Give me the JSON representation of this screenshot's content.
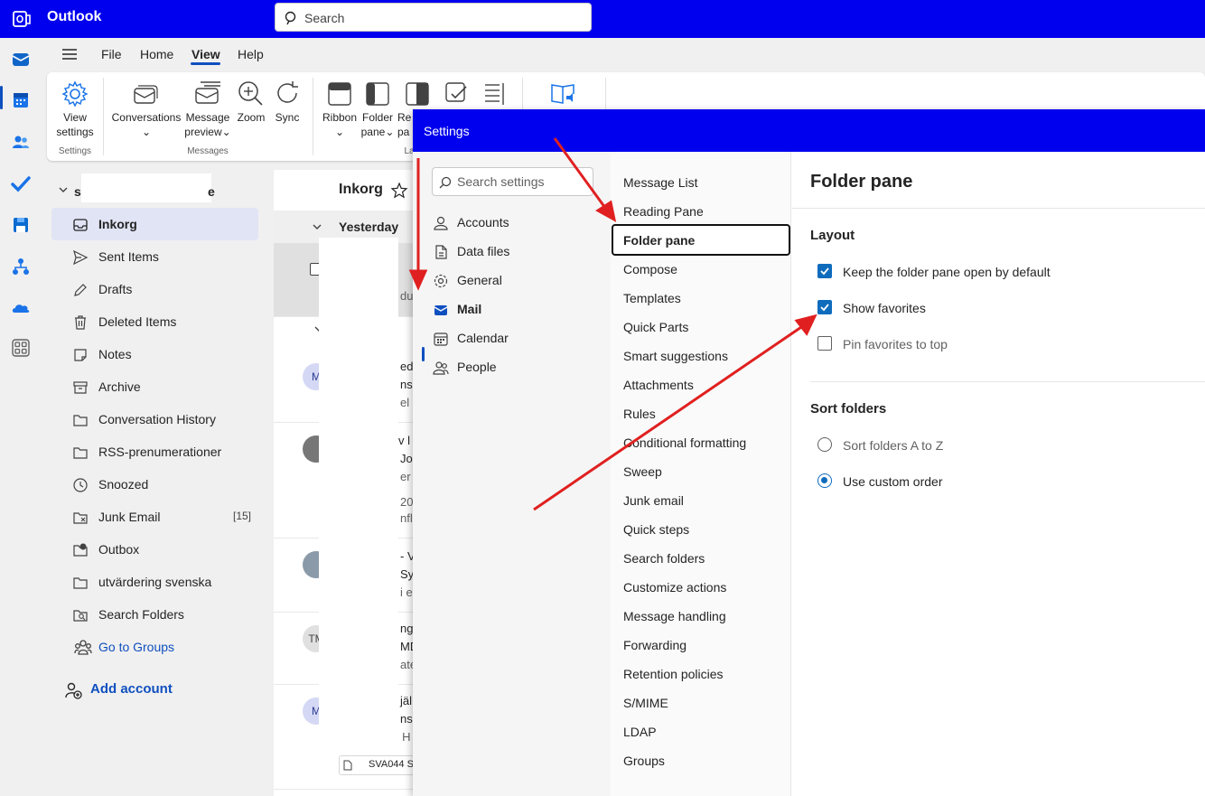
{
  "app": {
    "name": "Outlook",
    "search_placeholder": "Search"
  },
  "menu": {
    "items": [
      "File",
      "Home",
      "View",
      "Help"
    ],
    "active": "View"
  },
  "ribbon": {
    "view_settings": [
      "View",
      "settings"
    ],
    "settings_group": "Settings",
    "conversations": "Conversations",
    "message_preview": [
      "Message",
      "preview"
    ],
    "zoom": "Zoom",
    "sync": "Sync",
    "messages_group": "Messages",
    "ribbon": "Ribbon",
    "folder_pane": [
      "Folder",
      "pane"
    ],
    "reading_pane_fragment": [
      "Re",
      "pa"
    ],
    "layout_group_fragment": "La"
  },
  "folders": {
    "account_name_fragment": [
      "s",
      "e"
    ],
    "items": [
      {
        "name": "Inkorg",
        "icon": "inbox-icon",
        "active": true
      },
      {
        "name": "Sent Items",
        "icon": "send-icon"
      },
      {
        "name": "Drafts",
        "icon": "pencil-icon"
      },
      {
        "name": "Deleted Items",
        "icon": "trash-icon"
      },
      {
        "name": "Notes",
        "icon": "note-icon"
      },
      {
        "name": "Archive",
        "icon": "archive-icon"
      },
      {
        "name": "Conversation History",
        "icon": "folder-icon"
      },
      {
        "name": "RSS-prenumerationer",
        "icon": "folder-icon"
      },
      {
        "name": "Snoozed",
        "icon": "clock-icon"
      },
      {
        "name": "Junk Email",
        "icon": "junk-icon",
        "count": "[15]"
      },
      {
        "name": "Outbox",
        "icon": "outbox-icon"
      },
      {
        "name": "utvärdering svenska",
        "icon": "folder-icon"
      },
      {
        "name": "Search Folders",
        "icon": "search-folder-icon"
      }
    ],
    "go_to_groups": "Go to Groups",
    "add_account": "Add account"
  },
  "message_list": {
    "title": "Inkorg",
    "group_header": "Yesterday",
    "fragments": [
      "sö",
      "an",
      "du",
      "ed",
      "ns",
      "el",
      "v l",
      "Jo",
      "er",
      "20",
      "nfl",
      "- V",
      "Syr",
      "i e",
      "ng",
      "MD",
      "ate",
      "jäl",
      "ns:",
      "Benita: H",
      "SVA044 S"
    ],
    "avatars": [
      "M",
      "TM",
      "M"
    ]
  },
  "settings": {
    "title": "Settings",
    "search_placeholder": "Search settings",
    "categories": [
      {
        "label": "Accounts",
        "icon": "person-icon"
      },
      {
        "label": "Data files",
        "icon": "file-icon"
      },
      {
        "label": "General",
        "icon": "gear-icon"
      },
      {
        "label": "Mail",
        "icon": "mail-icon",
        "active": true
      },
      {
        "label": "Calendar",
        "icon": "calendar-icon"
      },
      {
        "label": "People",
        "icon": "people-icon"
      }
    ],
    "mail_sections": [
      "Message List",
      "Reading Pane",
      "Folder pane",
      "Compose",
      "Templates",
      "Quick Parts",
      "Smart suggestions",
      "Attachments",
      "Rules",
      "Conditional formatting",
      "Sweep",
      "Junk email",
      "Quick steps",
      "Search folders",
      "Customize actions",
      "Message handling",
      "Forwarding",
      "Retention policies",
      "S/MIME",
      "LDAP",
      "Groups"
    ],
    "active_section": "Folder pane",
    "content": {
      "heading": "Folder pane",
      "layout_heading": "Layout",
      "keep_open": {
        "label": "Keep the folder pane open by default",
        "checked": true
      },
      "show_favorites": {
        "label": "Show favorites",
        "checked": true
      },
      "pin_favorites": {
        "label": "Pin favorites to top",
        "checked": false
      },
      "sort_heading": "Sort folders",
      "sort_az": {
        "label": "Sort folders A to Z",
        "selected": false
      },
      "custom_order": {
        "label": "Use custom order",
        "selected": true
      }
    }
  },
  "colors": {
    "brand": "#0000ee",
    "accent": "#0f6cbd",
    "annotation": "#e02020"
  }
}
